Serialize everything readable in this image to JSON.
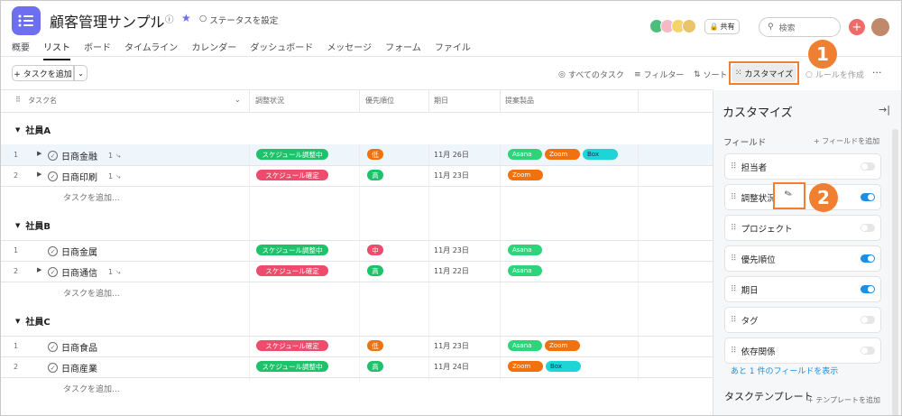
{
  "header": {
    "title": "顧客管理サンプル",
    "status_label": "ステータスを設定",
    "share_label": "共有",
    "search_placeholder": "検索"
  },
  "tabs": [
    "概要",
    "リスト",
    "ボード",
    "タイムライン",
    "カレンダー",
    "ダッシュボード",
    "メッセージ",
    "フォーム",
    "ファイル"
  ],
  "toolbar": {
    "add_task": "+ タスクを追加",
    "all_tasks": "すべてのタスク",
    "filter": "フィルター",
    "sort": "ソート",
    "customize": "カスタマイズ",
    "create_rule": "ルールを作成"
  },
  "columns": {
    "task": "タスク名",
    "status": "調整状況",
    "priority": "優先順位",
    "date": "期日",
    "product": "提案製品"
  },
  "sections": [
    {
      "name": "社員A",
      "add": "タスクを追加...",
      "rows": [
        {
          "num": "1",
          "name": "日商金融",
          "sub": "1",
          "status": "スケジュール調整中",
          "priority": "低",
          "date": "11月 26日",
          "tags": [
            "Asana",
            "Zoom",
            "Box"
          ]
        },
        {
          "num": "2",
          "name": "日商印刷",
          "sub": "1",
          "status": "スケジュール確定",
          "priority": "高",
          "date": "11月 23日",
          "tags": [
            "Zoom"
          ]
        }
      ]
    },
    {
      "name": "社員B",
      "add": "タスクを追加...",
      "rows": [
        {
          "num": "1",
          "name": "日商金属",
          "sub": "",
          "status": "スケジュール調整中",
          "priority": "中",
          "date": "11月 23日",
          "tags": [
            "Asana"
          ]
        },
        {
          "num": "2",
          "name": "日商通信",
          "sub": "1",
          "status": "スケジュール確定",
          "priority": "高",
          "date": "11月 22日",
          "tags": [
            "Asana"
          ]
        }
      ]
    },
    {
      "name": "社員C",
      "add": "タスクを追加...",
      "rows": [
        {
          "num": "1",
          "name": "日商食品",
          "sub": "",
          "status": "スケジュール確定",
          "priority": "低",
          "date": "11月 23日",
          "tags": [
            "Asana",
            "Zoom"
          ]
        },
        {
          "num": "2",
          "name": "日商産業",
          "sub": "",
          "status": "スケジュール調整中",
          "priority": "高",
          "date": "11月 24日",
          "tags": [
            "Zoom",
            "Box"
          ]
        }
      ]
    }
  ],
  "panel": {
    "title": "カスタマイズ",
    "fields_label": "フィールド",
    "add_field": "+ フィールドを追加",
    "fields": [
      {
        "name": "担当者",
        "on": false
      },
      {
        "name": "調整状況",
        "on": true
      },
      {
        "name": "プロジェクト",
        "on": false
      },
      {
        "name": "優先順位",
        "on": true
      },
      {
        "name": "期日",
        "on": true
      },
      {
        "name": "タグ",
        "on": false
      },
      {
        "name": "依存関係",
        "on": false
      }
    ],
    "show_more": "あと 1 件のフィールドを表示",
    "template_label": "タスクテンプレート",
    "add_template": "+ テンプレートを追加"
  },
  "callouts": [
    "1",
    "2"
  ],
  "colors": {
    "accent": "#f07f32",
    "status_in_progress": "#1ec26a",
    "status_confirmed": "#ee4c6c",
    "priority_low": "#f1710f",
    "priority_mid": "#ee4c6c",
    "priority_high": "#1ec26a",
    "tag_asana": "#2ed47a",
    "tag_zoom": "#f1710f",
    "tag_box": "#1ed4d4",
    "toggle_on": "#1a8fe3"
  }
}
